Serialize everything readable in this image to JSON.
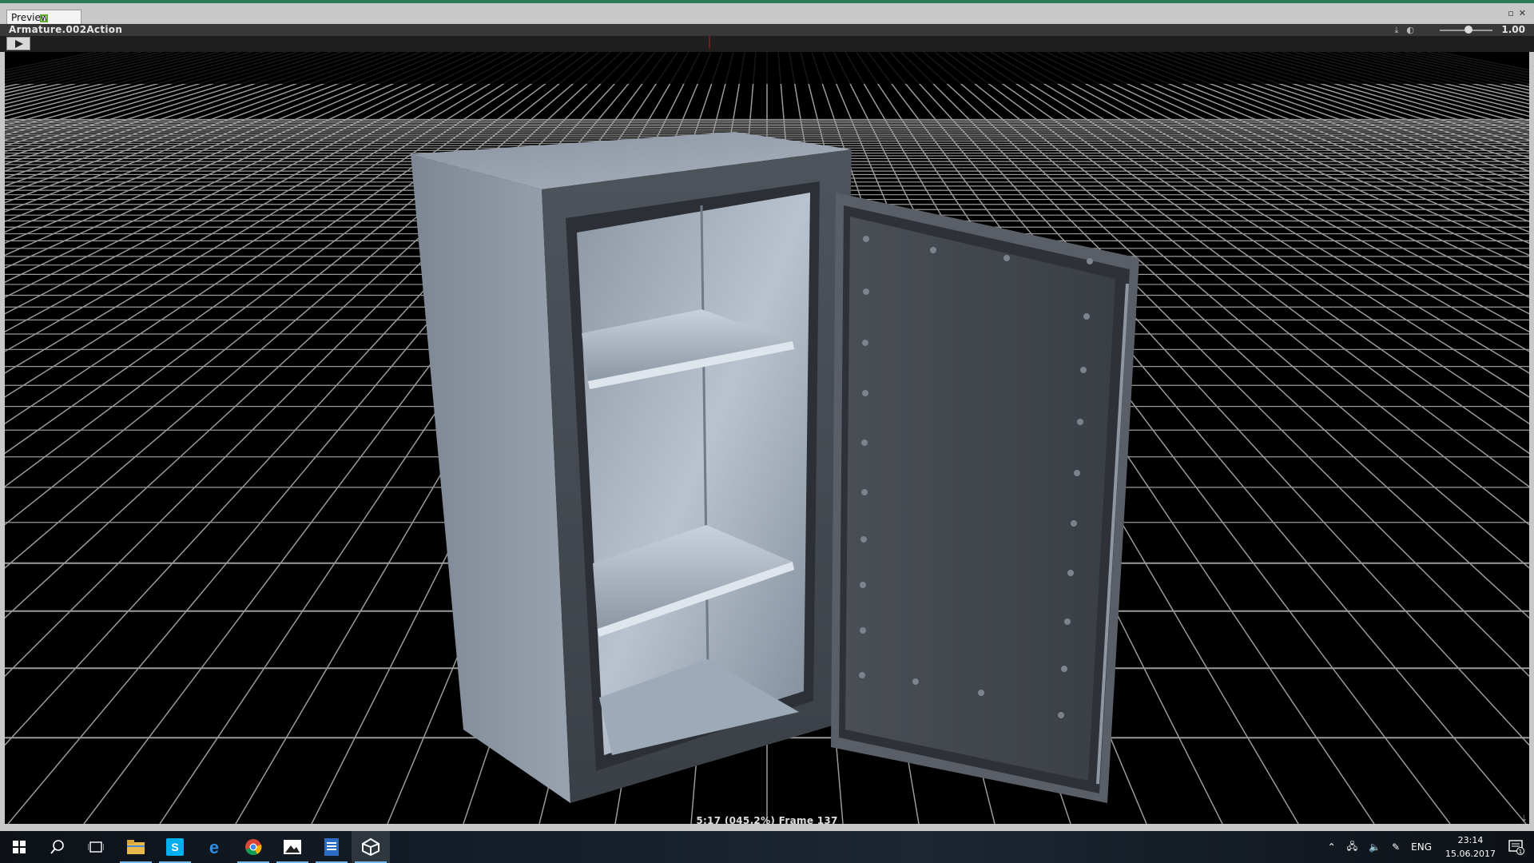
{
  "window": {
    "tab_label": "Preview",
    "controls": [
      "restore-icon",
      "close-icon"
    ]
  },
  "preview": {
    "clip_name": "Armature.002Action",
    "speed_value": "1.00",
    "speed_fraction": 0.55,
    "play_icon": "play-icon",
    "frame_info": "5:17 (045.2%) Frame 137"
  },
  "viewport": {
    "object": "safe-model",
    "grid_color": "#9a9a9a"
  },
  "taskbar": {
    "apps": [
      {
        "name": "start",
        "icon": "windows-icon"
      },
      {
        "name": "search",
        "icon": "search-icon"
      },
      {
        "name": "task-view",
        "icon": "task-view-icon"
      },
      {
        "name": "file-explorer",
        "icon": "folder-icon",
        "active": true
      },
      {
        "name": "skype",
        "icon": "skype-icon",
        "active": true
      },
      {
        "name": "edge",
        "icon": "edge-icon",
        "active": false
      },
      {
        "name": "chrome",
        "icon": "chrome-icon",
        "active": true
      },
      {
        "name": "photos",
        "icon": "photos-icon",
        "active": true
      },
      {
        "name": "notepad",
        "icon": "document-icon",
        "active": true
      },
      {
        "name": "unity",
        "icon": "unity-icon",
        "active": true,
        "focused": true
      }
    ],
    "tray": {
      "language": "ENG",
      "time": "23:14",
      "date": "15.06.2017",
      "notification_count": "1"
    }
  }
}
